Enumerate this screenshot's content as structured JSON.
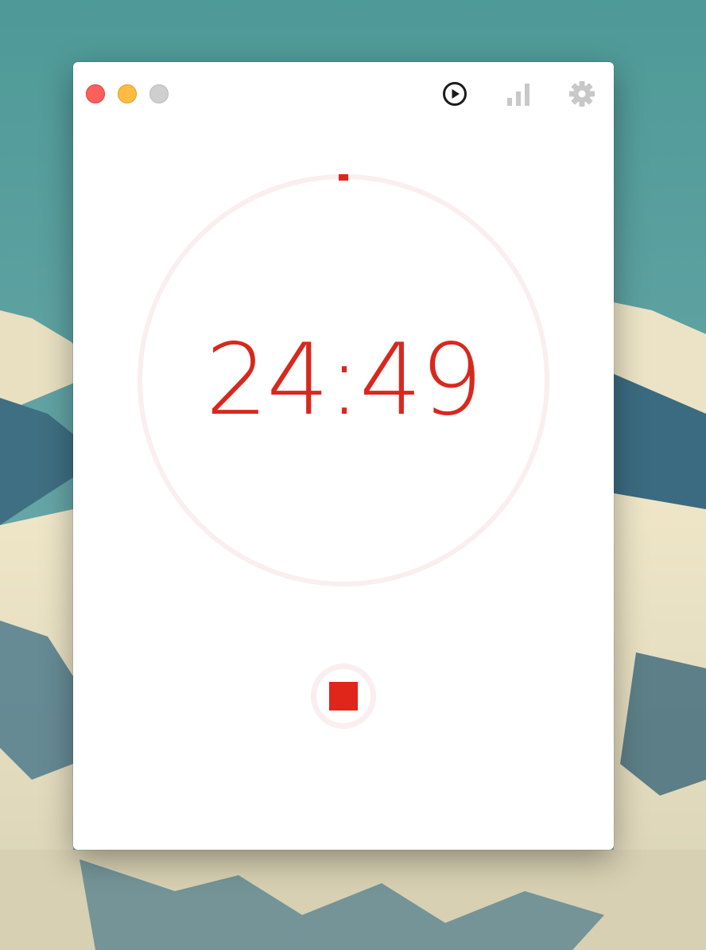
{
  "window": {
    "controls": [
      "close",
      "minimize",
      "zoom"
    ]
  },
  "toolbar": {
    "buttons": [
      {
        "icon": "play-circle-icon",
        "state": "active"
      },
      {
        "icon": "bar-chart-icon",
        "state": "inactive"
      },
      {
        "icon": "gear-icon",
        "state": "inactive"
      }
    ]
  },
  "timer": {
    "time": "24:49",
    "progress_fraction": 0.007,
    "state": "running"
  },
  "controls": {
    "stop_icon": "stop-icon"
  },
  "colors": {
    "accent": "#e0251b",
    "ring_track": "#faeeee",
    "close": "#fc605c",
    "minimize": "#fdbc40",
    "zoom": "#cfcfcf",
    "toolbar_active": "#1a1a1a",
    "toolbar_inactive": "#c8c8c8"
  }
}
